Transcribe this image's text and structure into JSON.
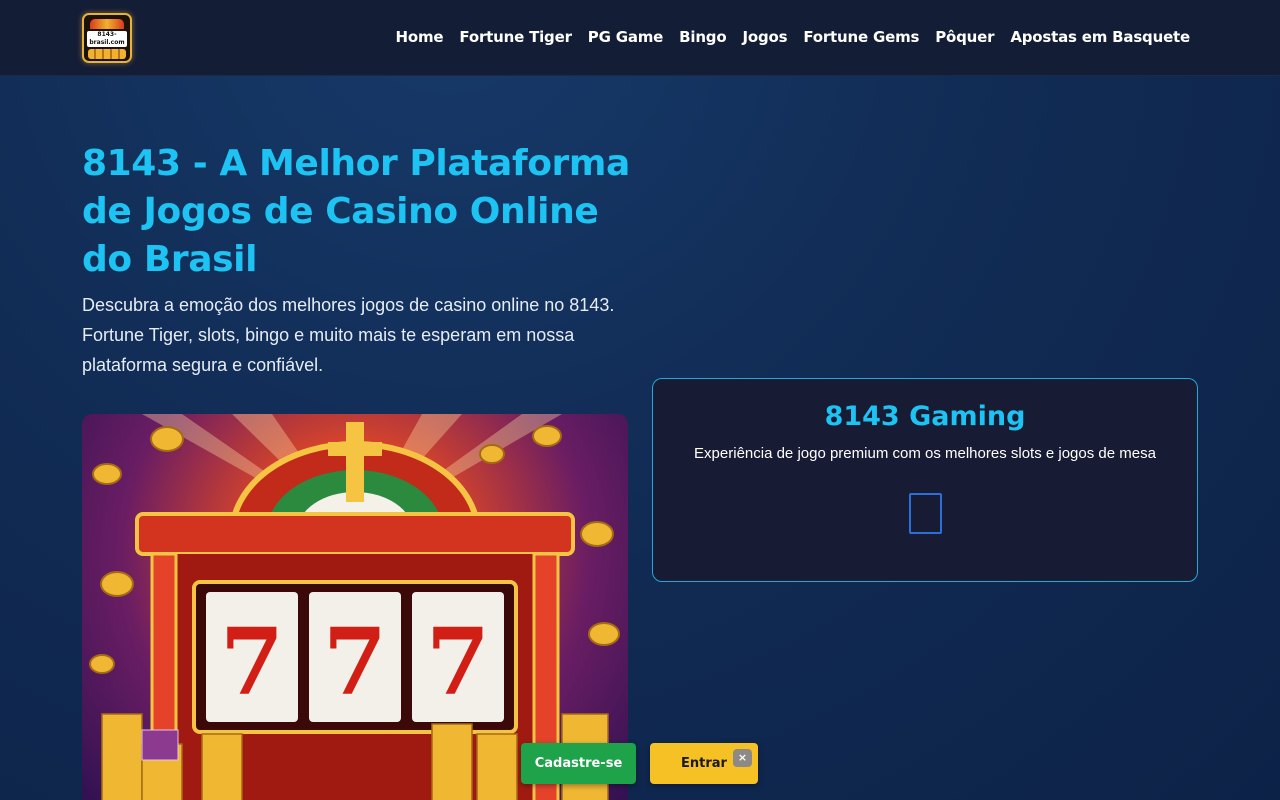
{
  "header": {
    "logo_text": "8143-brasil.com",
    "nav": [
      {
        "label": "Home"
      },
      {
        "label": "Fortune Tiger"
      },
      {
        "label": "PG Game"
      },
      {
        "label": "Bingo"
      },
      {
        "label": "Jogos"
      },
      {
        "label": "Fortune Gems"
      },
      {
        "label": "Pôquer"
      },
      {
        "label": "Apostas em Basquete"
      }
    ]
  },
  "hero": {
    "title": "8143 - A Melhor Plataforma de Jogos de Casino Online do Brasil",
    "description": "Descubra a emoção dos melhores jogos de casino online no 8143. Fortune Tiger, slots, bingo e muito mais te esperam em nossa plataforma segura e confiável."
  },
  "gaming_card": {
    "title": "8143 Gaming",
    "subtitle": "Experiência de jogo premium com os melhores slots e jogos de mesa"
  },
  "floating_actions": {
    "signup_label": "Cadastre-se",
    "login_label": "Entrar",
    "close_label": "×"
  },
  "colors": {
    "accent": "#1dc4f3",
    "header_bg": "#141d36",
    "signup_bg": "#1ea24a",
    "login_bg": "#f5c125"
  }
}
